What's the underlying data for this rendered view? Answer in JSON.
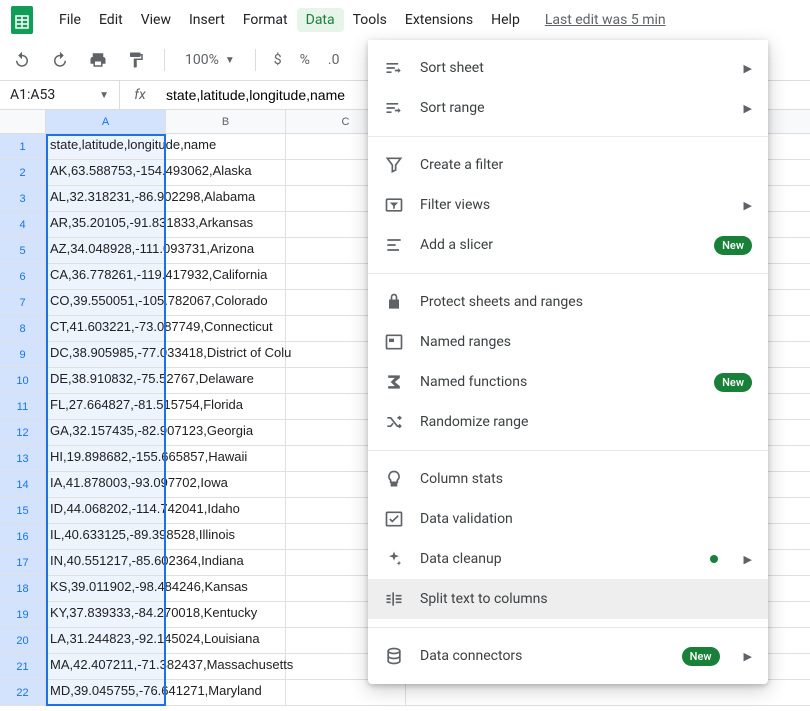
{
  "menubar": {
    "items": [
      "File",
      "Edit",
      "View",
      "Insert",
      "Format",
      "Data",
      "Tools",
      "Extensions",
      "Help"
    ],
    "active_index": 5,
    "last_edit": "Last edit was 5 min"
  },
  "toolbar": {
    "zoom": "100%",
    "currency": "$",
    "percent": "%",
    "decimal_dec": ".0"
  },
  "name_box": {
    "value": "A1:A53",
    "fx_label": "fx",
    "formula": "state,latitude,longitude,name"
  },
  "grid": {
    "columns": [
      "A",
      "B",
      "C"
    ],
    "selected_col_index": 0,
    "rows": [
      {
        "n": 1,
        "a": "state,latitude,longitude,name"
      },
      {
        "n": 2,
        "a": "AK,63.588753,-154.493062,Alaska"
      },
      {
        "n": 3,
        "a": "AL,32.318231,-86.902298,Alabama"
      },
      {
        "n": 4,
        "a": "AR,35.20105,-91.831833,Arkansas"
      },
      {
        "n": 5,
        "a": "AZ,34.048928,-111.093731,Arizona"
      },
      {
        "n": 6,
        "a": "CA,36.778261,-119.417932,California"
      },
      {
        "n": 7,
        "a": "CO,39.550051,-105.782067,Colorado"
      },
      {
        "n": 8,
        "a": "CT,41.603221,-73.087749,Connecticut"
      },
      {
        "n": 9,
        "a": "DC,38.905985,-77.033418,District of Colu"
      },
      {
        "n": 10,
        "a": "DE,38.910832,-75.52767,Delaware"
      },
      {
        "n": 11,
        "a": "FL,27.664827,-81.515754,Florida"
      },
      {
        "n": 12,
        "a": "GA,32.157435,-82.907123,Georgia"
      },
      {
        "n": 13,
        "a": "HI,19.898682,-155.665857,Hawaii"
      },
      {
        "n": 14,
        "a": "IA,41.878003,-93.097702,Iowa"
      },
      {
        "n": 15,
        "a": "ID,44.068202,-114.742041,Idaho"
      },
      {
        "n": 16,
        "a": "IL,40.633125,-89.398528,Illinois"
      },
      {
        "n": 17,
        "a": "IN,40.551217,-85.602364,Indiana"
      },
      {
        "n": 18,
        "a": "KS,39.011902,-98.484246,Kansas"
      },
      {
        "n": 19,
        "a": "KY,37.839333,-84.270018,Kentucky"
      },
      {
        "n": 20,
        "a": "LA,31.244823,-92.145024,Louisiana"
      },
      {
        "n": 21,
        "a": "MA,42.407211,-71.382437,Massachusetts"
      },
      {
        "n": 22,
        "a": "MD,39.045755,-76.641271,Maryland"
      }
    ]
  },
  "dropdown": {
    "sections": [
      [
        {
          "icon": "sort",
          "label": "Sort sheet",
          "arrow": true
        },
        {
          "icon": "sort",
          "label": "Sort range",
          "arrow": true
        }
      ],
      [
        {
          "icon": "filter",
          "label": "Create a filter"
        },
        {
          "icon": "filterviews",
          "label": "Filter views",
          "arrow": true
        },
        {
          "icon": "slicer",
          "label": "Add a slicer",
          "badge": "New"
        }
      ],
      [
        {
          "icon": "lock",
          "label": "Protect sheets and ranges"
        },
        {
          "icon": "named",
          "label": "Named ranges"
        },
        {
          "icon": "sigma",
          "label": "Named functions",
          "badge": "New"
        },
        {
          "icon": "shuffle",
          "label": "Randomize range"
        }
      ],
      [
        {
          "icon": "bulb",
          "label": "Column stats"
        },
        {
          "icon": "check",
          "label": "Data validation"
        },
        {
          "icon": "sparkle",
          "label": "Data cleanup",
          "dot": true,
          "arrow": true
        },
        {
          "icon": "split",
          "label": "Split text to columns",
          "highlight": true
        }
      ],
      [
        {
          "icon": "db",
          "label": "Data connectors",
          "badge": "New",
          "arrow": true
        }
      ]
    ]
  }
}
